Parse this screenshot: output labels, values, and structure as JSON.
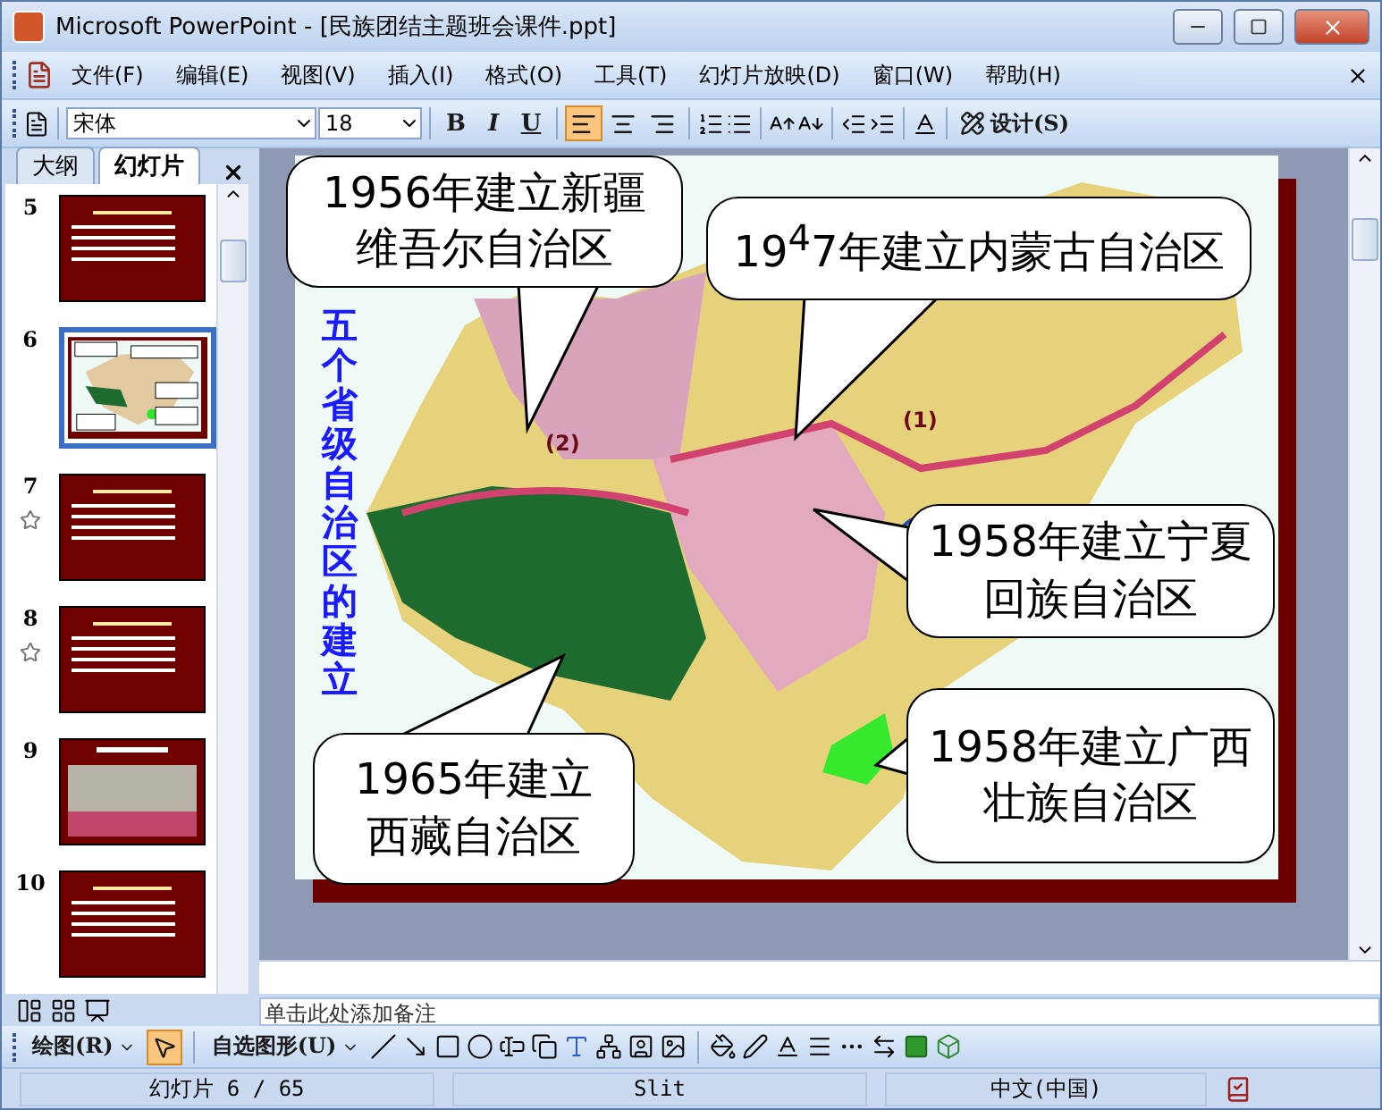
{
  "window": {
    "title": "Microsoft PowerPoint - [民族团结主题班会课件.ppt]"
  },
  "menu": [
    "文件(F)",
    "编辑(E)",
    "视图(V)",
    "插入(I)",
    "格式(O)",
    "工具(T)",
    "幻灯片放映(D)",
    "窗口(W)",
    "帮助(H)"
  ],
  "formatting_toolbar": {
    "font": "宋体",
    "size": "18",
    "design_label": "设计(S)",
    "styles": [
      {
        "label": "B",
        "kind": "bold"
      },
      {
        "label": "I",
        "kind": "italic"
      },
      {
        "label": "U",
        "kind": "underline"
      }
    ],
    "alignment": [
      {
        "kind": "left",
        "selected": true
      },
      {
        "kind": "center",
        "selected": false
      },
      {
        "kind": "right",
        "selected": false
      }
    ]
  },
  "pane_tabs": [
    {
      "label": "大纲",
      "selected": false
    },
    {
      "label": "幻灯片",
      "selected": true
    }
  ],
  "slides": [
    {
      "number": "5",
      "kind": "text",
      "selected": false,
      "animated": false
    },
    {
      "number": "6",
      "kind": "map",
      "selected": true,
      "animated": false
    },
    {
      "number": "7",
      "kind": "text",
      "selected": false,
      "animated": true
    },
    {
      "number": "8",
      "kind": "text",
      "selected": false,
      "animated": true
    },
    {
      "number": "9",
      "kind": "photo",
      "selected": false,
      "animated": false
    },
    {
      "number": "10",
      "kind": "text",
      "selected": false,
      "animated": false
    }
  ],
  "slide": {
    "vertical_title": "五个省级自治区的建立",
    "map_labels": [
      "(2)",
      "(1)"
    ],
    "callouts": [
      {
        "kind": "xinjiang",
        "lines": [
          "1956年建立新疆",
          "维吾尔自治区"
        ]
      },
      {
        "kind": "neimenggu",
        "lines": [
          "19$^{4}$7年建立内蒙古自治区"
        ]
      },
      {
        "kind": "ningxia",
        "lines": [
          "1958年建立宁夏",
          "回族自治区"
        ]
      },
      {
        "kind": "guangxi",
        "lines": [
          "1958年建立广西",
          "壮族自治区"
        ]
      },
      {
        "kind": "xizang",
        "lines": [
          "1965年建立",
          "西藏自治区"
        ]
      }
    ]
  },
  "notes": {
    "placeholder": "单击此处添加备注"
  },
  "drawing_toolbar": {
    "draw_label": "绘图(R)",
    "autoshapes_label": "自选图形(U)",
    "pointer_selected": true
  },
  "status_bar": [
    "幻灯片 6 / 65",
    "Slit",
    "中文(中国)"
  ]
}
